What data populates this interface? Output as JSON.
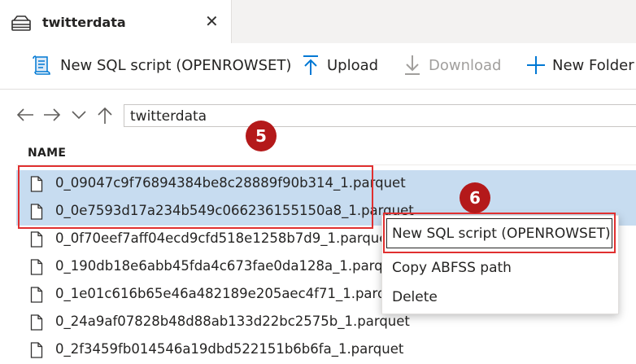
{
  "tab": {
    "title": "twitterdata",
    "close_icon": "close-icon"
  },
  "toolbar": {
    "new_sql_script": "New SQL script (OPENROWSET)",
    "upload": "Upload",
    "download": "Download",
    "new_folder": "New Folder"
  },
  "nav": {
    "path": "twitterdata"
  },
  "list": {
    "column_name": "NAME",
    "files": [
      {
        "name": "0_09047c9f76894384be8c28889f90b314_1.parquet",
        "selected": true
      },
      {
        "name": "0_0e7593d17a234b549c066236155150a8_1.parquet",
        "selected": true
      },
      {
        "name": "0_0f70eef7aff04ecd9cfd518e1258b7d9_1.parquet",
        "selected": false
      },
      {
        "name": "0_190db18e6abb45fda4c673fae0da128a_1.parquet",
        "selected": false
      },
      {
        "name": "0_1e01c616b65e46a482189e205aec4f71_1.parquet",
        "selected": false
      },
      {
        "name": "0_24a9af07828b48d88ab133d22bc2575b_1.parquet",
        "selected": false
      },
      {
        "name": "0_2f3459fb014546a19dbd522151b6b6fa_1.parquet",
        "selected": false
      }
    ]
  },
  "context_menu": {
    "items": [
      "New SQL script (OPENROWSET)",
      "Copy ABFSS path",
      "Delete"
    ]
  },
  "callouts": {
    "step5": "5",
    "step6": "6"
  },
  "colors": {
    "selection": "#c7dcf0",
    "callout_red": "#e03030",
    "badge": "#b4191a",
    "accent_blue": "#0078d4"
  }
}
